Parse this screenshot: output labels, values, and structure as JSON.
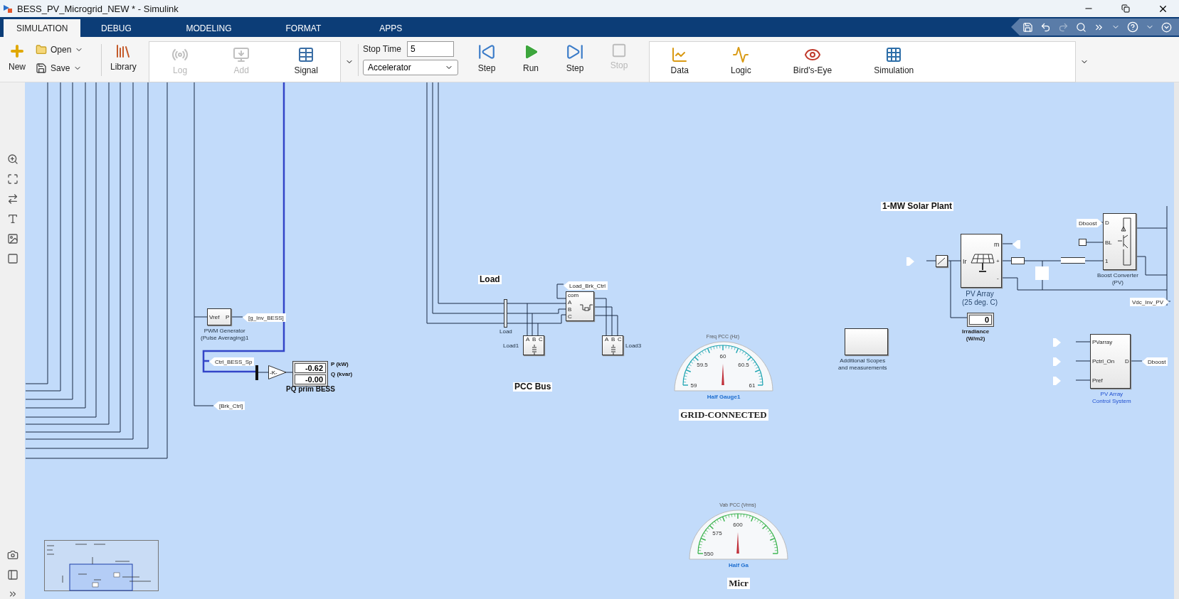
{
  "window": {
    "title": "BESS_PV_Microgrid_NEW * - Simulink"
  },
  "tabs": [
    {
      "label": "SIMULATION",
      "selected": true
    },
    {
      "label": "DEBUG",
      "selected": false
    },
    {
      "label": "MODELING",
      "selected": false
    },
    {
      "label": "FORMAT",
      "selected": false
    },
    {
      "label": "APPS",
      "selected": false
    }
  ],
  "toolstrip": {
    "new": "New",
    "open": "Open",
    "save": "Save",
    "library": "Library",
    "prepare": [
      {
        "label": "Log",
        "disabled": true
      },
      {
        "label": "Add",
        "disabled": true
      },
      {
        "label": "Signal",
        "disabled": false
      }
    ],
    "stop_time": {
      "label": "Stop Time",
      "value": "5"
    },
    "mode": "Accelerator",
    "simulate": [
      {
        "kind": "back",
        "label": "Step",
        "disabled": false
      },
      {
        "kind": "run",
        "label": "Run",
        "disabled": false
      },
      {
        "kind": "forward",
        "label": "Step",
        "disabled": false
      },
      {
        "kind": "stop",
        "label": "Stop",
        "disabled": true
      }
    ],
    "review": [
      "Data",
      "Logic",
      "Bird's-Eye",
      "Simulation"
    ]
  },
  "diagram": {
    "pwm": {
      "ports": [
        "Vref",
        "P"
      ],
      "caption": [
        "PWM Generator",
        "(Pulse Averaging)1"
      ]
    },
    "tags": [
      "[g_Inv_BESS]",
      "Ctrl_BESS_Sp",
      "[Brk_Ctrl]",
      "Load_Brk_Ctrl",
      "Dboost",
      "Dboost",
      "Vdc_Inv_PV"
    ],
    "gain": "-K-",
    "pq_display": {
      "title": "PQ prim BESS",
      "rows": [
        {
          "value": "-0.62",
          "unit": "P (kW)"
        },
        {
          "value": "-0.00",
          "unit": "Q (kvar)"
        }
      ]
    },
    "load_title": "Load",
    "bus_label": "Load",
    "pcc_label": "PCC Bus",
    "breaker_ports": [
      "com",
      "A",
      "B",
      "C"
    ],
    "loads": [
      {
        "name": "Load1",
        "ports": [
          "A",
          "B",
          "C"
        ]
      },
      {
        "name": "Load3",
        "ports": [
          "A",
          "B",
          "C"
        ]
      }
    ],
    "gauges": [
      {
        "title": "Freq PCC (Hz)",
        "ticks": [
          "59",
          "59.5",
          "60",
          "60.5",
          "61"
        ],
        "name": "Half Gauge1",
        "color": "#1aa3b0",
        "caption": "GRID-CONNECTED"
      },
      {
        "title": "Vab PCC (Vrms)",
        "ticks": [
          "550",
          "575",
          "600"
        ],
        "name": "Half Ga",
        "color": "#36b24a",
        "caption": "Micr"
      }
    ],
    "solar_title": "1-MW Solar Plant",
    "pv_array": {
      "ports": [
        "Ir",
        "m",
        "+",
        "-"
      ],
      "caption": [
        "PV Array",
        "(25 deg. C)"
      ]
    },
    "irradiance": {
      "value": "0",
      "caption": [
        "Irradiance",
        "(W/m2)"
      ]
    },
    "boost": {
      "ports": [
        "D",
        "BL",
        "1"
      ],
      "caption": [
        "Boost Converter",
        "(PV)"
      ]
    },
    "scopes": {
      "caption": [
        "Additional Scopes",
        "and measurements"
      ]
    },
    "control": {
      "inputs": [
        "PVarray",
        "Pctrl_On",
        "Pref"
      ],
      "output": "D",
      "caption": [
        "PV Array",
        "Control System"
      ]
    }
  }
}
